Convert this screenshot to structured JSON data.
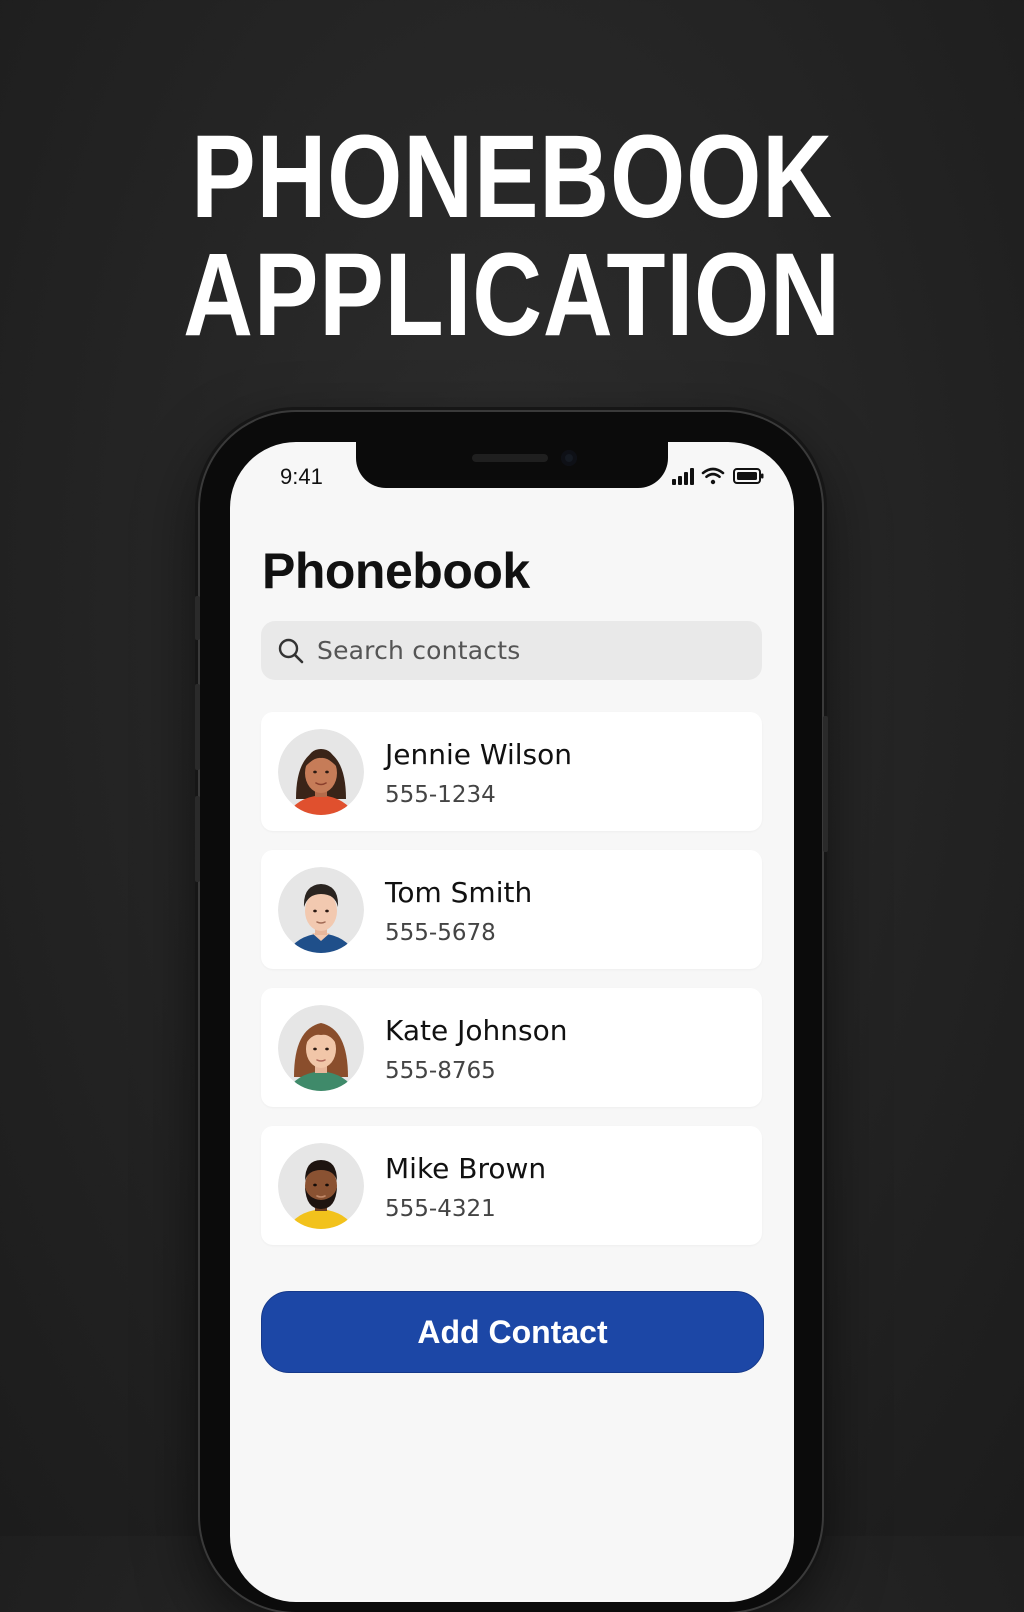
{
  "hero": {
    "line1": "PHONEBOOK",
    "line2": "APPLICATION"
  },
  "status_bar": {
    "time": "9:41",
    "icons": [
      "signal-bars-icon",
      "wifi-icon",
      "battery-icon"
    ]
  },
  "app": {
    "title": "Phonebook"
  },
  "search": {
    "placeholder": "Search contacts",
    "icon": "search-icon"
  },
  "contacts": [
    {
      "name": "Jennie Wilson",
      "phone": "555-1234",
      "avatar": "woman-dark-hair-avatar"
    },
    {
      "name": "Tom Smith",
      "phone": "555-5678",
      "avatar": "man-short-hair-avatar"
    },
    {
      "name": "Kate Johnson",
      "phone": "555-8765",
      "avatar": "woman-brown-hair-avatar"
    },
    {
      "name": "Mike Brown",
      "phone": "555-4321",
      "avatar": "man-beard-avatar"
    }
  ],
  "actions": {
    "add_contact_label": "Add Contact"
  },
  "colors": {
    "background": "#232323",
    "screen": "#f7f7f7",
    "card": "#ffffff",
    "search_bg": "#e9e9e9",
    "primary_button": "#1c47a6",
    "title_text": "#ffffff"
  }
}
